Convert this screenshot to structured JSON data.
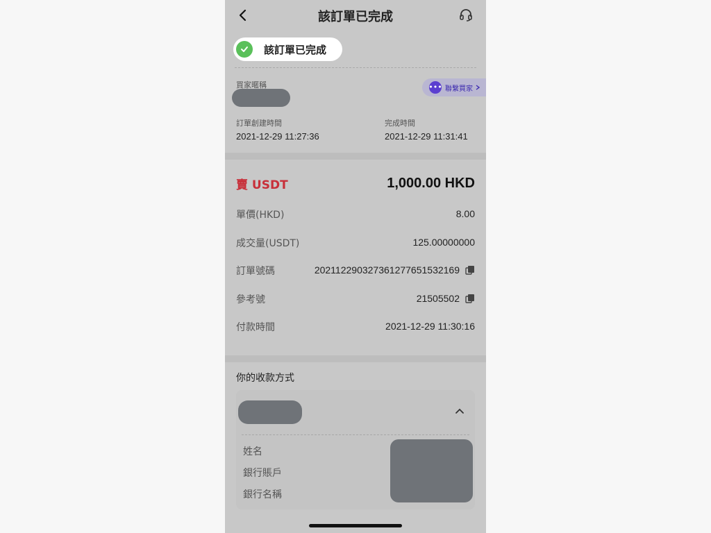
{
  "header": {
    "title": "該訂單已完成"
  },
  "status": {
    "text": "該訂單已完成",
    "color": "#5ac05a"
  },
  "buyer": {
    "nickname_label": "買家暱稱",
    "contact_label": "聯繫買家"
  },
  "order_times": {
    "created_label": "訂單創建時間",
    "created_value": "2021-12-29 11:27:36",
    "completed_label": "完成時間",
    "completed_value": "2021-12-29 11:31:41"
  },
  "trade": {
    "side_label": "賣 USDT",
    "side_color": "#c8303a",
    "amount": "1,000.00 HKD",
    "rows": [
      {
        "label": "單價(HKD)",
        "value": "8.00"
      },
      {
        "label": "成交量(USDT)",
        "value": "125.00000000"
      },
      {
        "label": "訂單號碼",
        "value": "20211229032736127765153216​9"
      },
      {
        "label": "參考號",
        "value": "21505502"
      },
      {
        "label": "付款時間",
        "value": "2021-12-29 11:30:16"
      }
    ]
  },
  "payment": {
    "title": "你的收款方式",
    "fields": [
      "姓名",
      "銀行賬戶",
      "銀行名稱"
    ]
  },
  "icons": {
    "back": "chevron-left-icon",
    "support": "headset-icon",
    "check": "check-icon",
    "chat": "chat-icon",
    "copy": "copy-icon",
    "collapse": "chevron-up-icon"
  }
}
